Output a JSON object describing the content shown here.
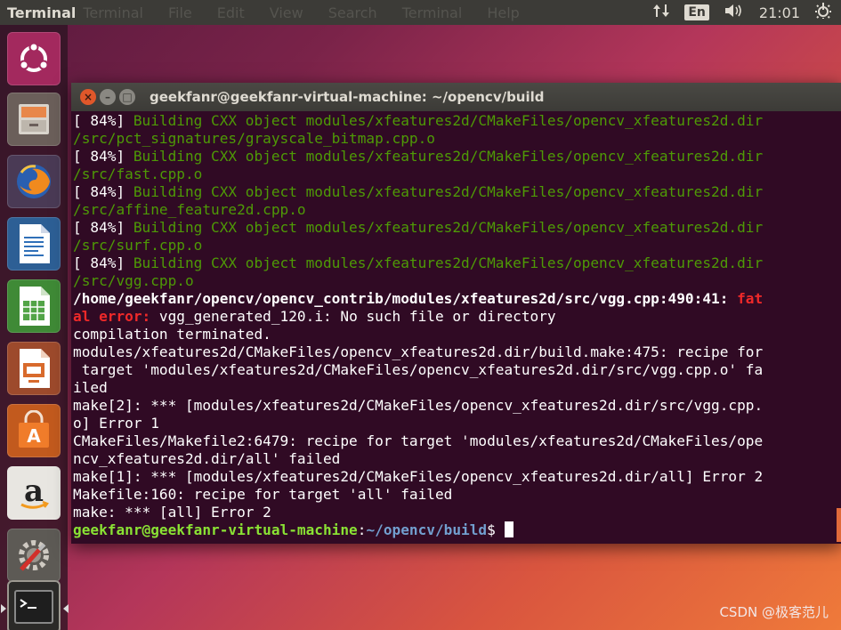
{
  "top_panel": {
    "app_title": "Terminal",
    "menu": [
      "Terminal",
      "File",
      "Edit",
      "View",
      "Search",
      "Terminal",
      "Help"
    ],
    "keyboard_layout": "En",
    "clock": "21:01",
    "icons": [
      "network-arrows-icon",
      "volume-icon",
      "settings-gear-icon"
    ]
  },
  "launcher": {
    "items": [
      "ubuntu-dash",
      "files",
      "firefox",
      "libreoffice-writer",
      "libreoffice-calc",
      "libreoffice-impress",
      "software-center",
      "amazon",
      "system-settings",
      "terminal"
    ]
  },
  "window": {
    "title": "geekfanr@geekfanr-virtual-machine: ~/opencv/build",
    "close_glyph": "×",
    "min_glyph": "–",
    "max_glyph": "□"
  },
  "terminal": {
    "lines": [
      [
        [
          "[ 84%] ",
          "w"
        ],
        [
          "Building CXX object modules/xfeatures2d/CMakeFiles/opencv_xfeatures2d.dir",
          "g"
        ]
      ],
      [
        [
          "/src/pct_signatures/grayscale_bitmap.cpp.o",
          "g"
        ]
      ],
      [
        [
          "[ 84%] ",
          "w"
        ],
        [
          "Building CXX object modules/xfeatures2d/CMakeFiles/opencv_xfeatures2d.dir",
          "g"
        ]
      ],
      [
        [
          "/src/fast.cpp.o",
          "g"
        ]
      ],
      [
        [
          "[ 84%] ",
          "w"
        ],
        [
          "Building CXX object modules/xfeatures2d/CMakeFiles/opencv_xfeatures2d.dir",
          "g"
        ]
      ],
      [
        [
          "/src/affine_feature2d.cpp.o",
          "g"
        ]
      ],
      [
        [
          "[ 84%] ",
          "w"
        ],
        [
          "Building CXX object modules/xfeatures2d/CMakeFiles/opencv_xfeatures2d.dir",
          "g"
        ]
      ],
      [
        [
          "/src/surf.cpp.o",
          "g"
        ]
      ],
      [
        [
          "[ 84%] ",
          "w"
        ],
        [
          "Building CXX object modules/xfeatures2d/CMakeFiles/opencv_xfeatures2d.dir",
          "g"
        ]
      ],
      [
        [
          "/src/vgg.cpp.o",
          "g"
        ]
      ],
      [
        [
          "/home/geekfanr/opencv/opencv_contrib/modules/xfeatures2d/src/vgg.cpp:490:41: ",
          "w b"
        ],
        [
          "fat",
          "r"
        ]
      ],
      [
        [
          "al error: ",
          "r"
        ],
        [
          "vgg_generated_120.i: No such file or directory",
          "w"
        ]
      ],
      [
        [
          "compilation terminated.",
          "w"
        ]
      ],
      [
        [
          "modules/xfeatures2d/CMakeFiles/opencv_xfeatures2d.dir/build.make:475: recipe for",
          "w"
        ]
      ],
      [
        [
          " target 'modules/xfeatures2d/CMakeFiles/opencv_xfeatures2d.dir/src/vgg.cpp.o' fa",
          "w"
        ]
      ],
      [
        [
          "iled",
          "w"
        ]
      ],
      [
        [
          "make[2]: *** [modules/xfeatures2d/CMakeFiles/opencv_xfeatures2d.dir/src/vgg.cpp.",
          "w"
        ]
      ],
      [
        [
          "o] Error 1",
          "w"
        ]
      ],
      [
        [
          "CMakeFiles/Makefile2:6479: recipe for target 'modules/xfeatures2d/CMakeFiles/ope",
          "w"
        ]
      ],
      [
        [
          "ncv_xfeatures2d.dir/all' failed",
          "w"
        ]
      ],
      [
        [
          "make[1]: *** [modules/xfeatures2d/CMakeFiles/opencv_xfeatures2d.dir/all] Error 2",
          "w"
        ]
      ],
      [
        [
          "Makefile:160: recipe for target 'all' failed",
          "w"
        ]
      ],
      [
        [
          "make: *** [all] Error 2",
          "w"
        ]
      ],
      [
        [
          "geekfanr@geekfanr-virtual-machine",
          "pg"
        ],
        [
          ":",
          "w"
        ],
        [
          "~/opencv/build",
          "pb"
        ],
        [
          "$ ",
          "w"
        ]
      ]
    ]
  },
  "watermark": "CSDN @极客范儿",
  "colors": {
    "terminal_bg": "#300a24",
    "build_green": "#4e9a06",
    "error_red": "#ef2929",
    "prompt_green": "#8ae234",
    "prompt_blue": "#729fcf"
  }
}
